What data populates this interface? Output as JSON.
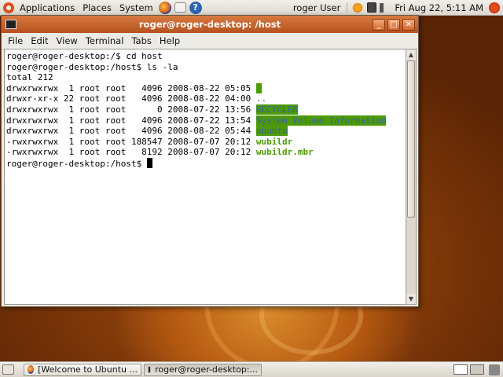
{
  "top_panel": {
    "menus": [
      "Applications",
      "Places",
      "System"
    ],
    "user": "roger User",
    "clock": "Fri Aug 22,  5:11 AM"
  },
  "window": {
    "title": "roger@roger-desktop: /host",
    "menu": [
      "File",
      "Edit",
      "View",
      "Terminal",
      "Tabs",
      "Help"
    ]
  },
  "terminal": {
    "lines": [
      {
        "text": "roger@roger-desktop:/$ cd host"
      },
      {
        "text": "roger@roger-desktop:/host$ ls -la"
      },
      {
        "text": "total 212"
      },
      {
        "text": "drwxrwxrwx  1 root root   4096 2008-08-22 05:05 ",
        "name": ".",
        "style": "hlblock"
      },
      {
        "text": "drwxr-xr-x 22 root root   4096 2008-08-22 04:00 ",
        "name": "..",
        "style": "dir"
      },
      {
        "text": "drwxrwxrwx  1 root root      0 2008-07-22 13:56 ",
        "name": "RECYCLER",
        "style": "hl"
      },
      {
        "text": "drwxrwxrwx  1 root root   4096 2008-07-22 13:54 ",
        "name": "System Volume Information",
        "style": "hl"
      },
      {
        "text": "drwxrwxrwx  1 root root   4096 2008-08-22 05:44 ",
        "name": "ubuntu",
        "style": "hl"
      },
      {
        "text": "-rwxrwxrwx  1 root root 188547 2008-07-07 20:12 ",
        "name": "wubildr",
        "style": "exe"
      },
      {
        "text": "-rwxrwxrwx  1 root root   8192 2008-07-07 20:12 ",
        "name": "wubildr.mbr",
        "style": "exe"
      },
      {
        "text": "roger@roger-desktop:/host$ ",
        "cursor": true
      }
    ]
  },
  "taskbar": {
    "items": [
      {
        "label": "[Welcome to Ubuntu ...",
        "active": false
      },
      {
        "label": "roger@roger-desktop:...",
        "active": true
      }
    ]
  },
  "colors": {
    "titlebar": "#c4622a",
    "dir_highlight": "#4e9a06",
    "dir_text": "#3465a4"
  }
}
